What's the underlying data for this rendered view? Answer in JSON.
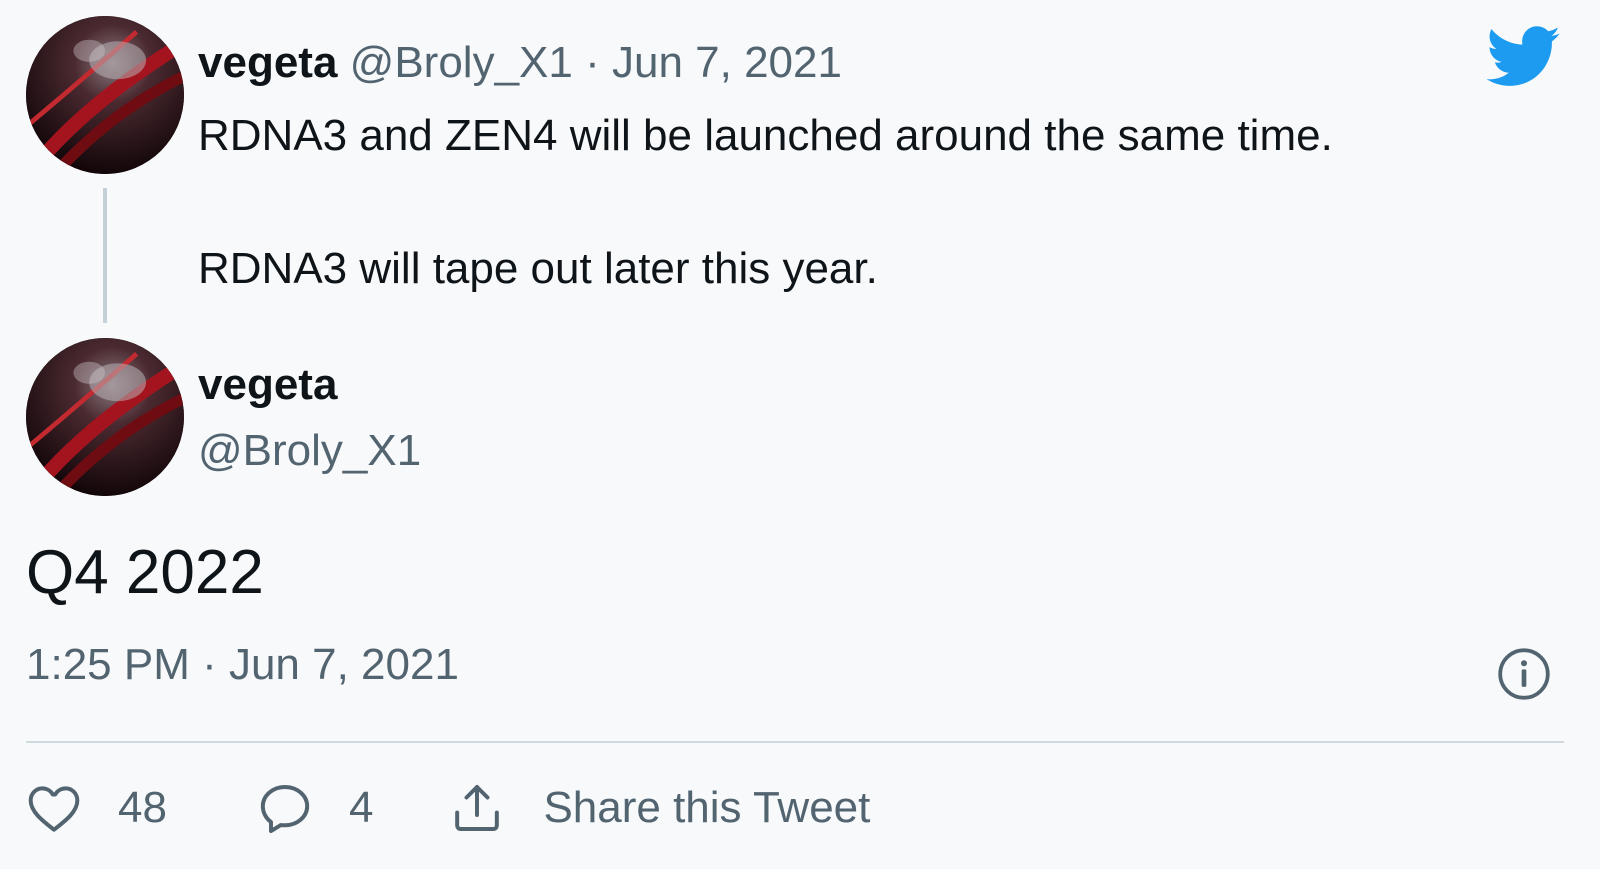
{
  "colors": {
    "background": "#f7f9fa",
    "text_primary": "#0f1419",
    "text_secondary": "#536471",
    "twitter_blue": "#1d9bf0",
    "thread_line": "#c4cfd6"
  },
  "icons": {
    "brand": "twitter-bird-icon",
    "info": "info-icon",
    "like": "heart-icon",
    "reply": "reply-bubble-icon",
    "share": "share-upload-icon"
  },
  "parent_tweet": {
    "display_name": "vegeta",
    "handle": "@Broly_X1",
    "separator": "·",
    "date": "Jun 7, 2021",
    "text_line1": "RDNA3 and ZEN4 will be launched around the same time.",
    "text_line2": "RDNA3 will tape out later this year."
  },
  "main_tweet": {
    "display_name": "vegeta",
    "handle": "@Broly_X1",
    "text": "Q4 2022",
    "timestamp": "1:25 PM · Jun 7, 2021"
  },
  "actions": {
    "like_count": "48",
    "reply_count": "4",
    "share_label": "Share this Tweet"
  }
}
